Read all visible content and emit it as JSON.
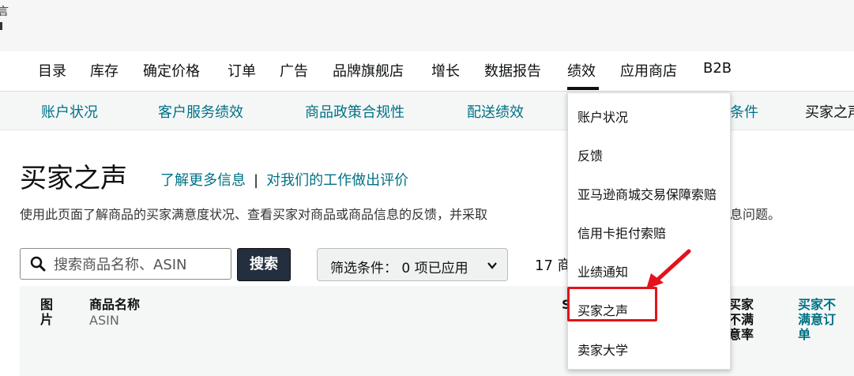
{
  "main_nav": {
    "items": [
      "目录",
      "库存",
      "确定价格",
      "订单",
      "广告",
      "品牌旗舰店",
      "增长",
      "数据报告",
      "绩效",
      "应用商店",
      "B2B"
    ],
    "active": "绩效"
  },
  "sub_nav": {
    "items": [
      "账户状况",
      "客户服务绩效",
      "商品政策合规性",
      "配送绩效"
    ],
    "partial_item_1": "条件",
    "partial_item_2": "买家之声"
  },
  "page": {
    "title": "买家之声",
    "learn_more": "了解更多信息",
    "separator": "|",
    "feedback_link": "对我们的工作做出评价",
    "description": "使用此页面了解商品的买家满意度状况、查看买家对商品或商品信息的反馈，并采取",
    "description_tail": "息问题。"
  },
  "search": {
    "placeholder": "搜索商品名称、ASIN",
    "button_label": "搜索"
  },
  "filter": {
    "label": "筛选条件：  0 项已应用"
  },
  "results": {
    "count_text": "17 商"
  },
  "table_header": {
    "col_image": "图片",
    "col_name": "商品名称",
    "col_name_sub": "ASIN",
    "col_partial_s": "S",
    "col_buyer_unsat_rate": "买家不满意率",
    "col_buyer_unsat_orders": "买家不满意订单"
  },
  "dropdown": {
    "items": [
      "账户状况",
      "反馈",
      "亚马逊商城交易保障索赔",
      "信用卡拒付索赔",
      "业绩通知",
      "买家之声",
      "卖家大学"
    ],
    "highlighted": "买家之声"
  },
  "colors": {
    "link": "#007185",
    "annotation": "#e3121b",
    "search_button": "#232f3e"
  }
}
